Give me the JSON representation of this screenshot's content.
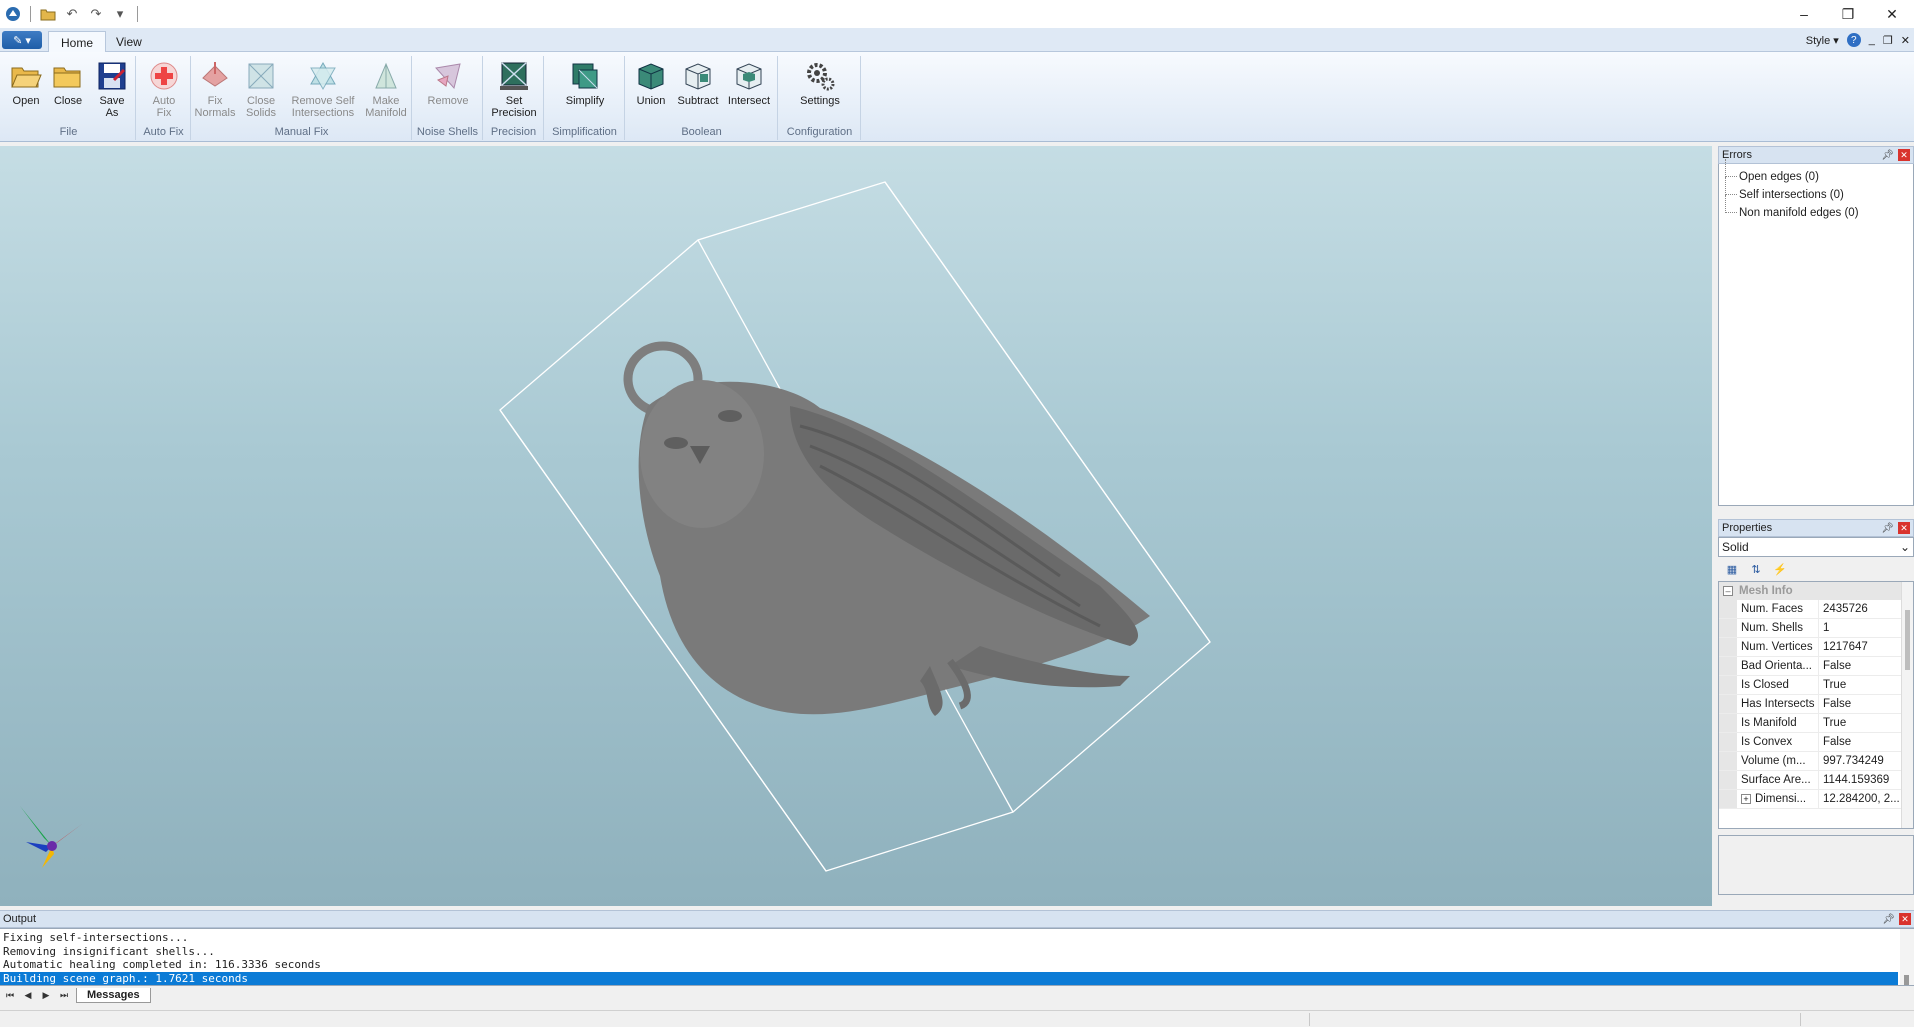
{
  "titlebar": {
    "quick_access_icons": [
      "app-icon",
      "open-icon",
      "undo-icon",
      "redo-icon",
      "customize-icon"
    ],
    "window_controls": {
      "minimize": "–",
      "restore": "❐",
      "close": "✕"
    }
  },
  "ribbon_tabs": [
    {
      "label": "Home",
      "active": true
    },
    {
      "label": "View",
      "active": false
    }
  ],
  "tabrow_right": {
    "style_label": "Style",
    "help": "?"
  },
  "ribbon": {
    "groups": [
      {
        "label": "File",
        "buttons": [
          {
            "label": "Open",
            "icon": "open-folder-icon"
          },
          {
            "label": "Close",
            "icon": "close-folder-icon"
          },
          {
            "label": "Save\nAs",
            "icon": "save-as-icon"
          }
        ]
      },
      {
        "label": "Auto Fix",
        "buttons": [
          {
            "label": "Auto\nFix",
            "icon": "auto-fix-icon",
            "disabled": true
          }
        ]
      },
      {
        "label": "Manual Fix",
        "buttons": [
          {
            "label": "Fix\nNormals",
            "icon": "fix-normals-icon",
            "disabled": true
          },
          {
            "label": "Close\nSolids",
            "icon": "close-solids-icon",
            "disabled": true
          },
          {
            "label": "Remove Self\nIntersections",
            "icon": "remove-self-intersections-icon",
            "disabled": true
          },
          {
            "label": "Make\nManifold",
            "icon": "make-manifold-icon",
            "disabled": true
          }
        ]
      },
      {
        "label": "Noise Shells",
        "buttons": [
          {
            "label": "Remove",
            "icon": "remove-shells-icon",
            "disabled": true
          }
        ]
      },
      {
        "label": "Precision",
        "buttons": [
          {
            "label": "Set\nPrecision",
            "icon": "set-precision-icon"
          }
        ]
      },
      {
        "label": "Simplification",
        "buttons": [
          {
            "label": "Simplify",
            "icon": "simplify-icon"
          }
        ]
      },
      {
        "label": "Boolean",
        "buttons": [
          {
            "label": "Union",
            "icon": "union-icon"
          },
          {
            "label": "Subtract",
            "icon": "subtract-icon"
          },
          {
            "label": "Intersect",
            "icon": "intersect-icon"
          }
        ]
      },
      {
        "label": "Configuration",
        "buttons": [
          {
            "label": "Settings",
            "icon": "settings-gear-icon"
          }
        ]
      }
    ]
  },
  "errors_panel": {
    "title": "Errors",
    "items": [
      "Open edges (0)",
      "Self intersections (0)",
      "Non manifold edges (0)"
    ]
  },
  "properties_panel": {
    "title": "Properties",
    "selected_object": "Solid",
    "category": "Mesh Info",
    "rows": [
      {
        "key": "Num. Faces",
        "value": "2435726"
      },
      {
        "key": "Num. Shells",
        "value": "1"
      },
      {
        "key": "Num. Vertices",
        "value": "1217647"
      },
      {
        "key": "Bad Orienta...",
        "value": "False"
      },
      {
        "key": "Is Closed",
        "value": "True"
      },
      {
        "key": "Has Intersects",
        "value": "False"
      },
      {
        "key": "Is Manifold",
        "value": "True"
      },
      {
        "key": "Is Convex",
        "value": "False"
      },
      {
        "key": "Volume (m...",
        "value": "997.734249"
      },
      {
        "key": "Surface Are...",
        "value": "1144.159369"
      },
      {
        "key": "Dimensi...",
        "value": "12.284200, 2..."
      }
    ]
  },
  "output_panel": {
    "title": "Output",
    "lines": [
      "Fixing self-intersections...",
      "Removing insignificant shells...",
      "Automatic healing completed in: 116.3336 seconds",
      "Building scene graph.: 1.7621 seconds"
    ],
    "selected_line": 3,
    "tab_label": "Messages"
  },
  "colors": {
    "accent": "#0b7bd6",
    "viewport_top": "#c5dde4",
    "viewport_bottom": "#8fb1bd",
    "model_gray": "#7a7a7a",
    "close_red": "#d9332d"
  }
}
